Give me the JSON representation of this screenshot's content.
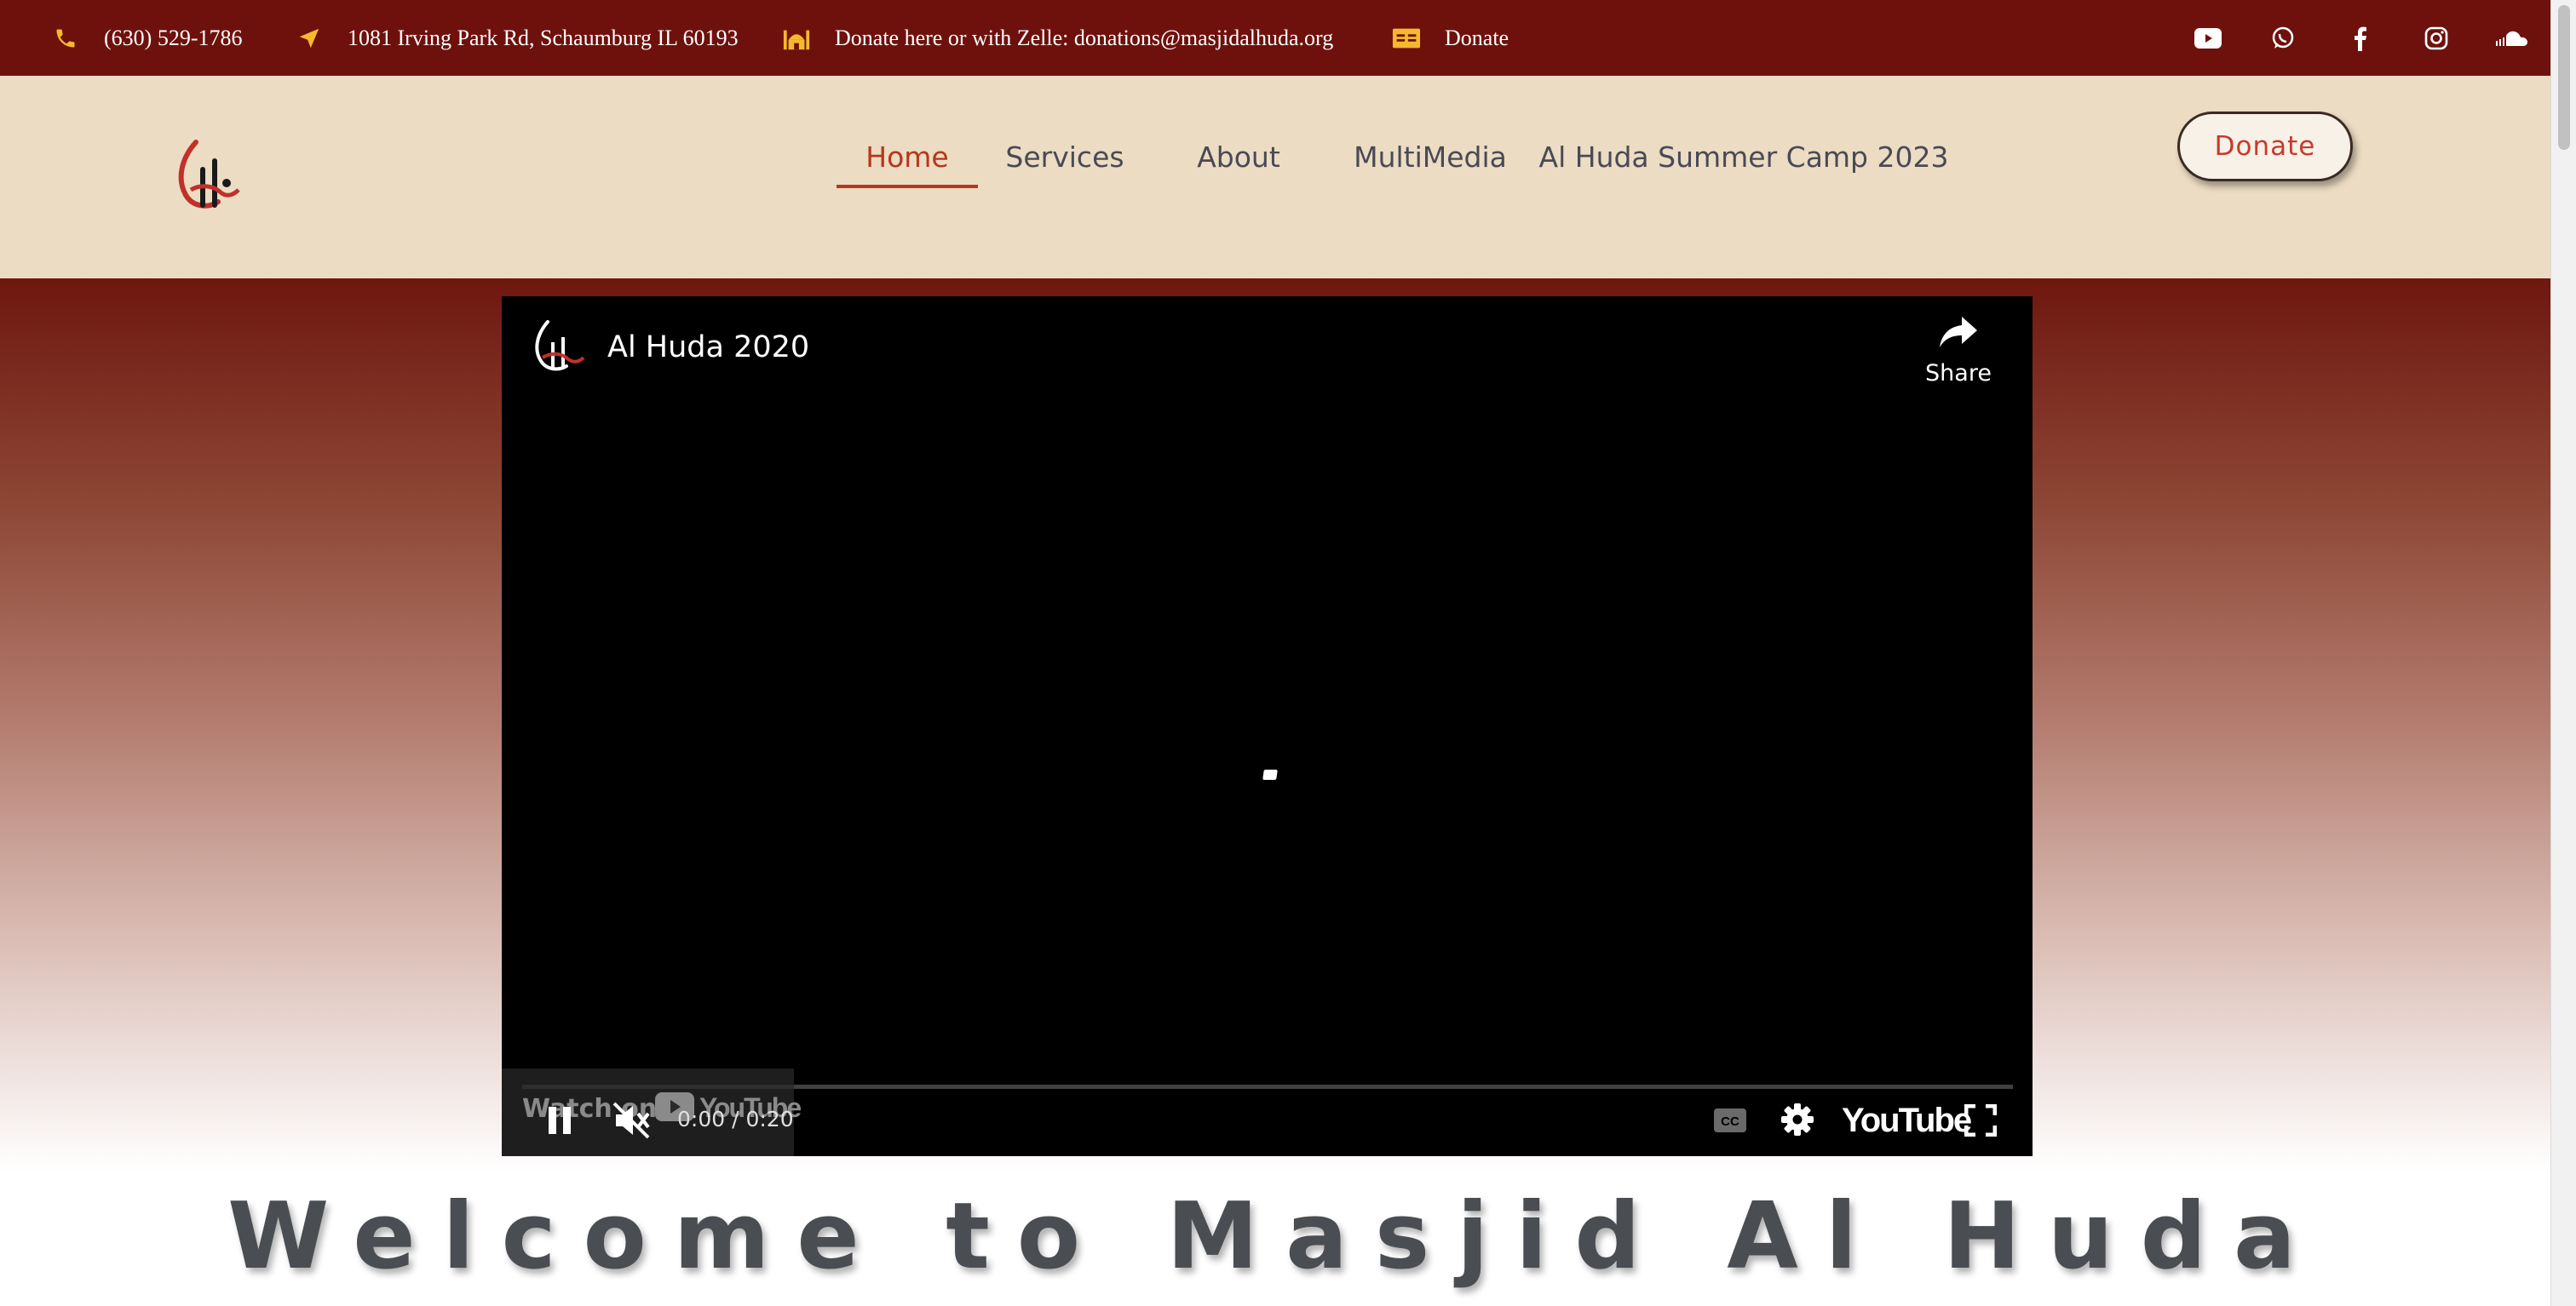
{
  "topbar": {
    "phone": "(630) 529-1786",
    "address": "1081 Irving Park Rd, Schaumburg IL 60193",
    "donate_zelle": "Donate here or with Zelle: donations@masjidalhuda.org",
    "donate_link": "Donate",
    "icons": [
      "phone-icon",
      "location-arrow-icon",
      "mosque-icon",
      "money-bill-icon"
    ],
    "social": [
      "youtube-icon",
      "whatsapp-icon",
      "facebook-icon",
      "instagram-icon",
      "soundcloud-icon"
    ],
    "color": "#6e110d",
    "accent_icon_color": "#f5b82e"
  },
  "header": {
    "nav": [
      {
        "label": "Home",
        "active": true
      },
      {
        "label": "Services",
        "active": false
      },
      {
        "label": "About",
        "active": false
      },
      {
        "label": "MultiMedia",
        "active": false
      },
      {
        "label": "Al Huda Summer Camp 2023",
        "active": false
      }
    ],
    "donate_button": "Donate",
    "background": "#ecdcc3",
    "active_color": "#b6361e"
  },
  "video": {
    "title": "Al Huda 2020",
    "share_label": "Share",
    "watch_on": "Watch on",
    "youtube_word": "YouTube",
    "time": "0:00 / 0:20",
    "progress": 0,
    "muted": true,
    "playing": true
  },
  "welcome": {
    "heading": "Welcome to Masjid Al Huda"
  }
}
